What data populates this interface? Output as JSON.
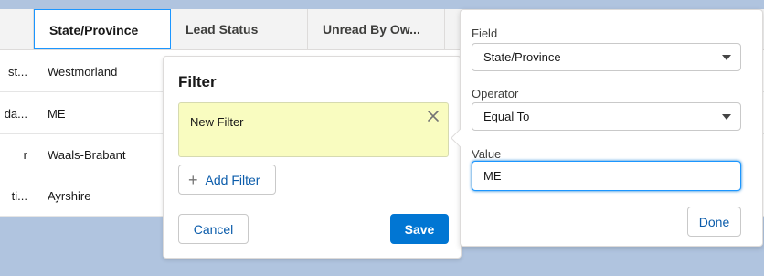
{
  "table": {
    "headers": [
      "",
      "State/Province",
      "Lead Status",
      "Unread By Ow...",
      ""
    ],
    "rows": [
      {
        "c0": "st...",
        "c1": "Westmorland"
      },
      {
        "c0": "da...",
        "c1": "ME"
      },
      {
        "c0": "r",
        "c1": "Waals-Brabant"
      },
      {
        "c0": "ti...",
        "c1": "Ayrshire"
      }
    ]
  },
  "filter_panel": {
    "title": "Filter",
    "card_label": "New Filter",
    "add_filter_label": "Add Filter",
    "cancel_label": "Cancel",
    "save_label": "Save",
    "icons": {
      "close": "close-icon",
      "add": "plus-icon"
    }
  },
  "popover": {
    "field_label": "Field",
    "field_value": "State/Province",
    "operator_label": "Operator",
    "operator_value": "Equal To",
    "value_label": "Value",
    "value_input": "ME",
    "done_label": "Done"
  },
  "colors": {
    "brand": "#0176d3",
    "link": "#0b5cab",
    "card_bg": "#f9fcc0",
    "page_bg": "#b0c4df"
  }
}
